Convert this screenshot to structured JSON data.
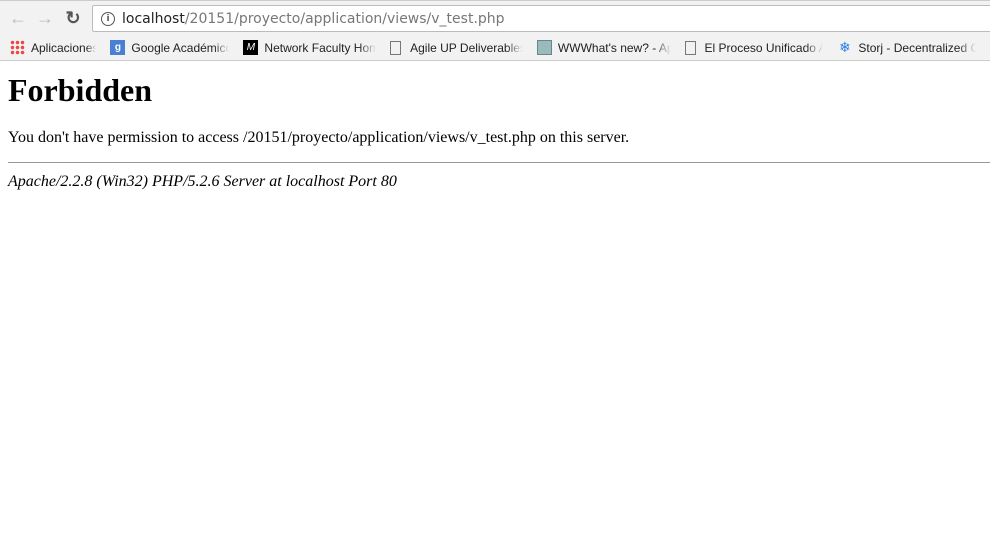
{
  "browser": {
    "url_host": "localhost",
    "url_path": "/20151/proyecto/application/views/v_test.php"
  },
  "bookmarks": [
    {
      "label": "Aplicaciones",
      "icon": "apps-grid-icon"
    },
    {
      "label": "Google Académico",
      "icon": "google-scholar-icon"
    },
    {
      "label": "Network Faculty Hom",
      "icon": "network-faculty-icon"
    },
    {
      "label": "Agile UP Deliverables",
      "icon": "page-icon"
    },
    {
      "label": "WWWhat's new? - Ap",
      "icon": "wwwhatsnew-icon"
    },
    {
      "label": "El Proceso Unificado A",
      "icon": "page-icon"
    },
    {
      "label": "Storj - Decentralized C",
      "icon": "storj-icon"
    }
  ],
  "page": {
    "title": "Forbidden",
    "message": "You don't have permission to access /20151/proyecto/application/views/v_test.php on this server.",
    "server": "Apache/2.2.8 (Win32) PHP/5.2.6 Server at localhost Port 80"
  }
}
